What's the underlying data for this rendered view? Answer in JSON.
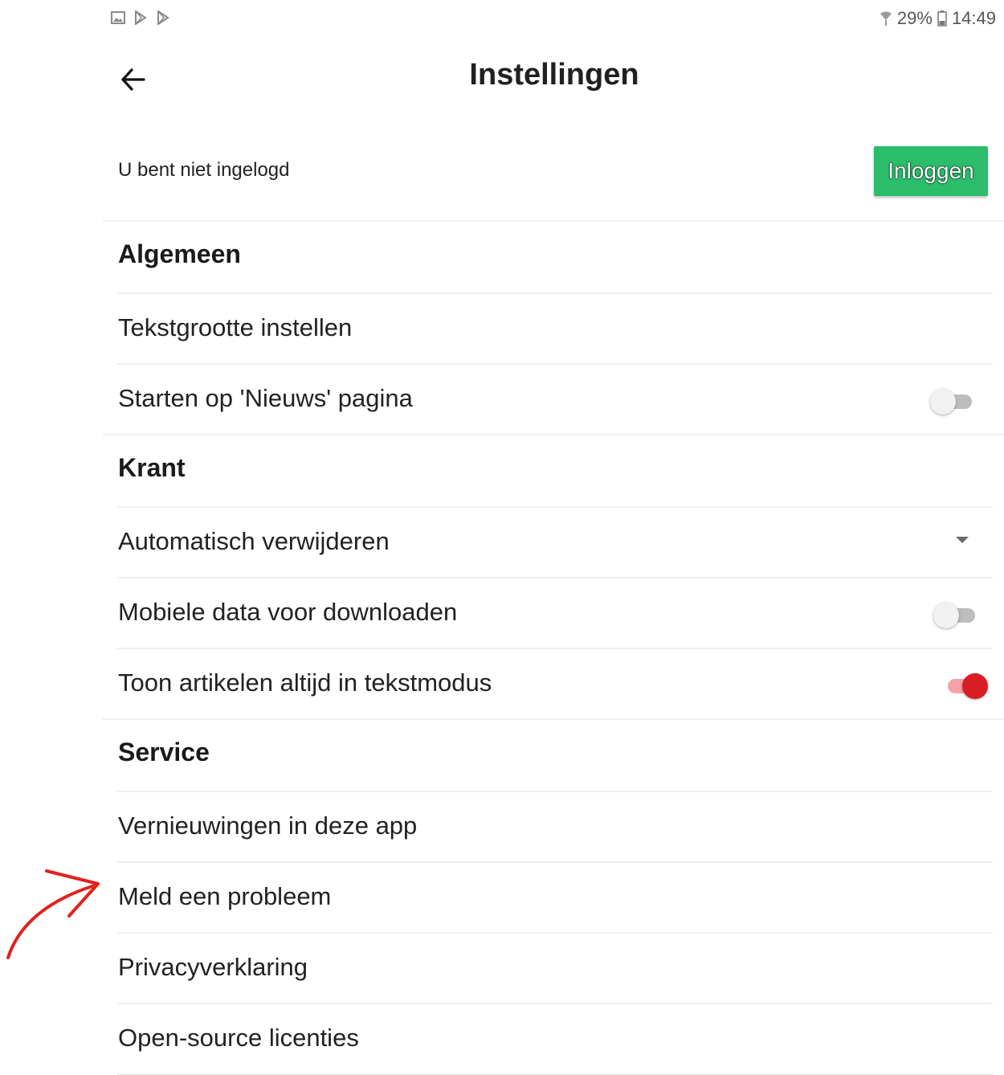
{
  "status_bar": {
    "left_icons": [
      "image-icon",
      "play-store-icon",
      "play-store-icon"
    ],
    "battery_percent": "29%",
    "time": "14:49"
  },
  "app_bar": {
    "title": "Instellingen",
    "back_icon": "arrow-left-icon"
  },
  "account": {
    "status_text": "U bent niet ingelogd",
    "login_label": "Inloggen",
    "login_color": "#2bbd6c"
  },
  "sections": [
    {
      "header": "Algemeen",
      "items": [
        {
          "label": "Tekstgrootte instellen",
          "control": "none"
        },
        {
          "label": "Starten op 'Nieuws' pagina",
          "control": "toggle",
          "checked": false
        }
      ]
    },
    {
      "header": "Krant",
      "items": [
        {
          "label": "Automatisch verwijderen",
          "control": "dropdown"
        },
        {
          "label": "Mobiele data voor downloaden",
          "control": "toggle",
          "checked": false
        },
        {
          "label": "Toon artikelen altijd in tekstmodus",
          "control": "toggle",
          "checked": true
        }
      ]
    },
    {
      "header": "Service",
      "items": [
        {
          "label": "Vernieuwingen in deze app",
          "control": "none"
        },
        {
          "label": "Meld een probleem",
          "control": "none"
        },
        {
          "label": "Privacyverklaring",
          "control": "none"
        },
        {
          "label": "Open-source licenties",
          "control": "none"
        }
      ]
    }
  ],
  "accent_color": "#d81e24",
  "annotation": {
    "type": "red-arrow",
    "color": "#e0221e",
    "points_to": "Meld een probleem"
  }
}
